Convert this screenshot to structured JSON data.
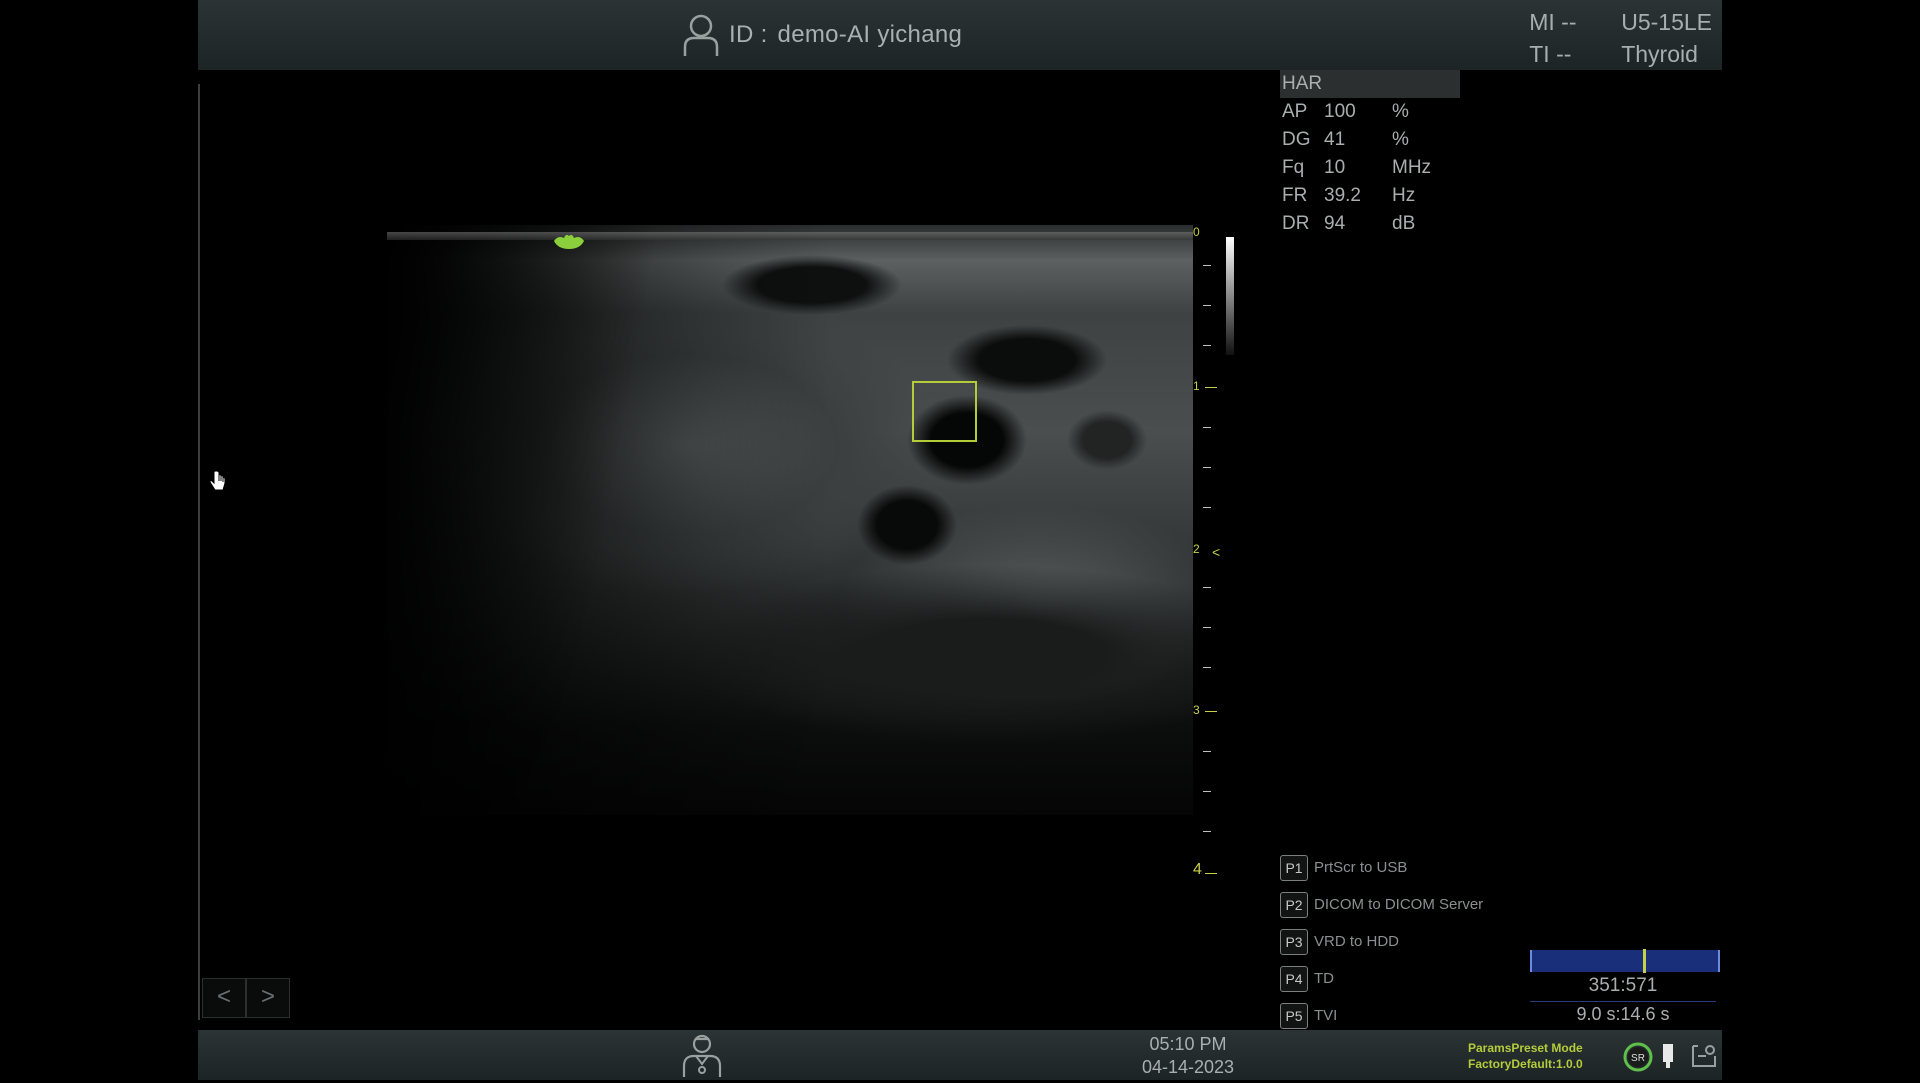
{
  "header": {
    "id_label": "ID :",
    "patient_id": "demo-AI yichang",
    "mi_label": "MI",
    "mi_value": "--",
    "ti_label": "TI",
    "ti_value": "--",
    "probe": "U5-15LE",
    "preset": "Thyroid"
  },
  "params": {
    "mode": "HAR",
    "rows": [
      {
        "key": "AP",
        "value": "100",
        "unit": "%"
      },
      {
        "key": "DG",
        "value": "41",
        "unit": "%"
      },
      {
        "key": "Fq",
        "value": "10",
        "unit": "MHz"
      },
      {
        "key": "FR",
        "value": "39.2",
        "unit": "Hz"
      },
      {
        "key": "DR",
        "value": "94",
        "unit": "dB"
      }
    ]
  },
  "depth_scale": {
    "labels": [
      "0",
      "1",
      "2",
      "3",
      "4"
    ],
    "focus_depth": 2
  },
  "presets": [
    {
      "key": "P1",
      "label": "PrtScr to USB"
    },
    {
      "key": "P2",
      "label": "DICOM to DICOM Server"
    },
    {
      "key": "P3",
      "label": "VRD to HDD"
    },
    {
      "key": "P4",
      "label": "TD"
    },
    {
      "key": "P5",
      "label": "TVI"
    }
  ],
  "cine": {
    "frame": "351:571",
    "time": "9.0 s:14.6 s",
    "position_fraction": 0.61
  },
  "nav": {
    "prev": "<",
    "next": ">"
  },
  "footer": {
    "time": "05:10 PM",
    "date": "04-14-2023",
    "preset_mode_line1": "ParamsPreset Mode",
    "preset_mode_line2": "FactoryDefault:1.0.0",
    "sr_label": "SR"
  },
  "colors": {
    "accent": "#b4cc3a",
    "cine_bar": "#1a2f7a"
  },
  "icons": [
    "user-icon",
    "ginkgo-orientation-icon",
    "hand-cursor-icon",
    "doctor-icon",
    "sr-icon",
    "usb-icon",
    "network-icon"
  ]
}
